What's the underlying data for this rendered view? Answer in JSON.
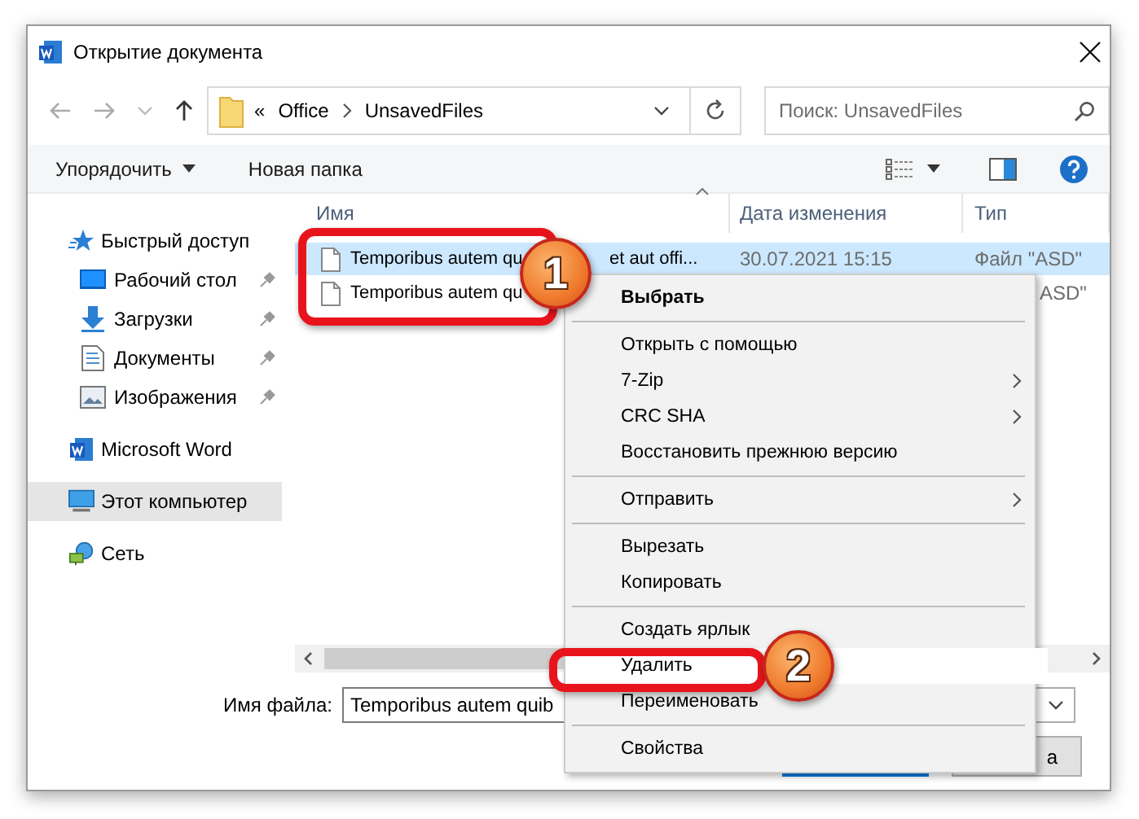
{
  "window": {
    "title": "Открытие документа"
  },
  "address": {
    "prefix": "«",
    "path": [
      "Office",
      "UnsavedFiles"
    ]
  },
  "search": {
    "placeholder": "Поиск: UnsavedFiles"
  },
  "toolbar": {
    "organize": "Упорядочить",
    "new_folder": "Новая папка"
  },
  "sidebar": {
    "items": [
      {
        "label": "Быстрый доступ",
        "selected": false,
        "children": [
          {
            "label": "Рабочий стол",
            "pinned": true,
            "selected": false
          },
          {
            "label": "Загрузки",
            "pinned": true,
            "selected": false
          },
          {
            "label": "Документы",
            "pinned": true,
            "selected": false
          },
          {
            "label": "Изображения",
            "pinned": true,
            "selected": false
          }
        ]
      },
      {
        "label": "Microsoft Word",
        "selected": false
      },
      {
        "label": "Этот компьютер",
        "selected": true
      },
      {
        "label": "Сеть",
        "selected": false
      }
    ]
  },
  "file_list": {
    "columns": [
      "Имя",
      "Дата изменения",
      "Тип"
    ],
    "rows": [
      {
        "name": "Temporibus autem qu",
        "name_tail": "et aut offi...",
        "date": "30.07.2021 15:15",
        "type": "Файл \"ASD\"",
        "selected": true
      },
      {
        "name": "Temporibus autem qu",
        "type": "ASD\"",
        "selected": false
      }
    ]
  },
  "filename": {
    "label": "Имя файла:",
    "value": "Temporibus autem quib"
  },
  "cancel_button": {
    "label": "а"
  },
  "context_menu": {
    "items": [
      {
        "kind": "default",
        "label": "Выбрать",
        "selected": false
      },
      {
        "kind": "separator"
      },
      {
        "kind": "item",
        "label": "Открыть с помощью",
        "selected": false
      },
      {
        "kind": "submenu",
        "label": "7-Zip",
        "selected": false
      },
      {
        "kind": "submenu",
        "label": "CRC SHA",
        "selected": false
      },
      {
        "kind": "item",
        "label": "Восстановить прежнюю версию",
        "selected": false
      },
      {
        "kind": "separator"
      },
      {
        "kind": "submenu",
        "label": "Отправить",
        "selected": false
      },
      {
        "kind": "separator"
      },
      {
        "kind": "item",
        "label": "Вырезать",
        "selected": false
      },
      {
        "kind": "item",
        "label": "Копировать",
        "selected": false
      },
      {
        "kind": "separator"
      },
      {
        "kind": "item",
        "label": "Создать ярлык",
        "selected": false
      },
      {
        "kind": "item",
        "label": "Удалить",
        "selected": true
      },
      {
        "kind": "item",
        "label": "Переименовать",
        "selected": false
      },
      {
        "kind": "separator"
      },
      {
        "kind": "item",
        "label": "Свойства",
        "selected": false
      }
    ]
  },
  "annotations": [
    {
      "number": "1"
    },
    {
      "number": "2"
    }
  ]
}
